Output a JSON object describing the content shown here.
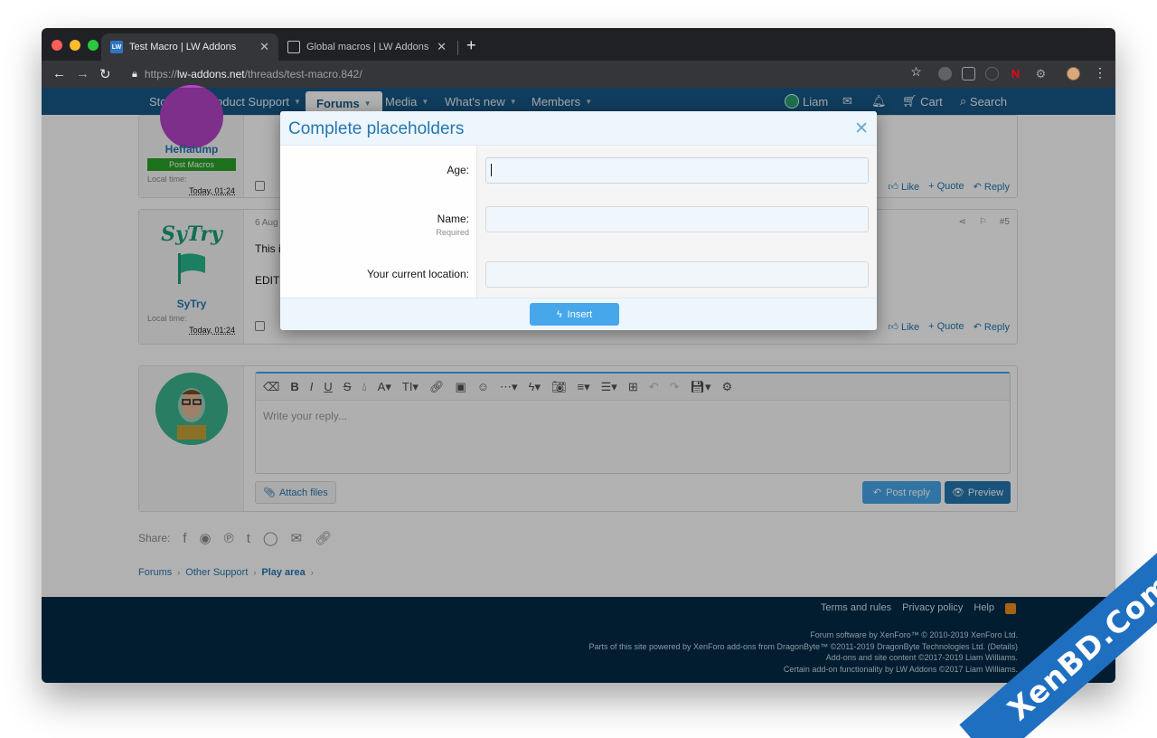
{
  "browser": {
    "tabs": [
      {
        "title": "Test Macro | LW Addons",
        "active": true
      },
      {
        "title": "Global macros | LW Addons - A",
        "active": false
      }
    ],
    "url_prefix": "https://",
    "url_host": "lw-addons.net",
    "url_path": "/threads/test-macro.842/"
  },
  "nav": {
    "items": [
      "Store",
      "Product Support",
      "Forums",
      "Media",
      "What's new",
      "Members"
    ],
    "active": "Forums",
    "user": "Liam",
    "cart": "Cart",
    "search": "Search"
  },
  "posts": [
    {
      "username": "Heffalump",
      "badge": "Post Macros",
      "local_time_label": "Local time:",
      "local_time": "Today, 01:24",
      "actions": [
        "Like",
        "+ Quote",
        "Reply"
      ]
    },
    {
      "username": "SyTry",
      "logo_text": "SyTry",
      "date": "6 Aug",
      "text_lines": [
        "This i",
        "EDIT"
      ],
      "post_number": "#5",
      "local_time_label": "Local time:",
      "local_time": "Today, 01:24",
      "actions": [
        "Like",
        "+ Quote",
        "Reply"
      ]
    }
  ],
  "reply": {
    "placeholder": "Write your reply...",
    "attach": "Attach files",
    "post_reply": "Post reply",
    "preview": "Preview"
  },
  "share": {
    "label": "Share:"
  },
  "breadcrumbs": [
    "Forums",
    "Other Support",
    "Play area"
  ],
  "footer": {
    "links": [
      "Terms and rules",
      "Privacy policy",
      "Help"
    ],
    "lines": [
      "Forum software by XenForo™ © 2010-2019 XenForo Ltd.",
      "Parts of this site powered by XenForo add-ons from DragonByte™ ©2011-2019 DragonByte Technologies Ltd. (Details)",
      "Add-ons and site content ©2017-2019 Liam Williams.",
      "Certain add-on functionality by LW Addons ©2017 Liam Williams."
    ]
  },
  "modal": {
    "title": "Complete placeholders",
    "fields": [
      {
        "label": "Age:",
        "hint": "",
        "value": ""
      },
      {
        "label": "Name:",
        "hint": "Required",
        "value": ""
      },
      {
        "label": "Your current location:",
        "hint": "",
        "value": ""
      }
    ],
    "insert": "Insert"
  },
  "watermark": "XenBD.Com",
  "colors": {
    "accent": "#2577b1",
    "nav": "#185886",
    "footer": "#032a46",
    "button": "#47a7eb"
  }
}
